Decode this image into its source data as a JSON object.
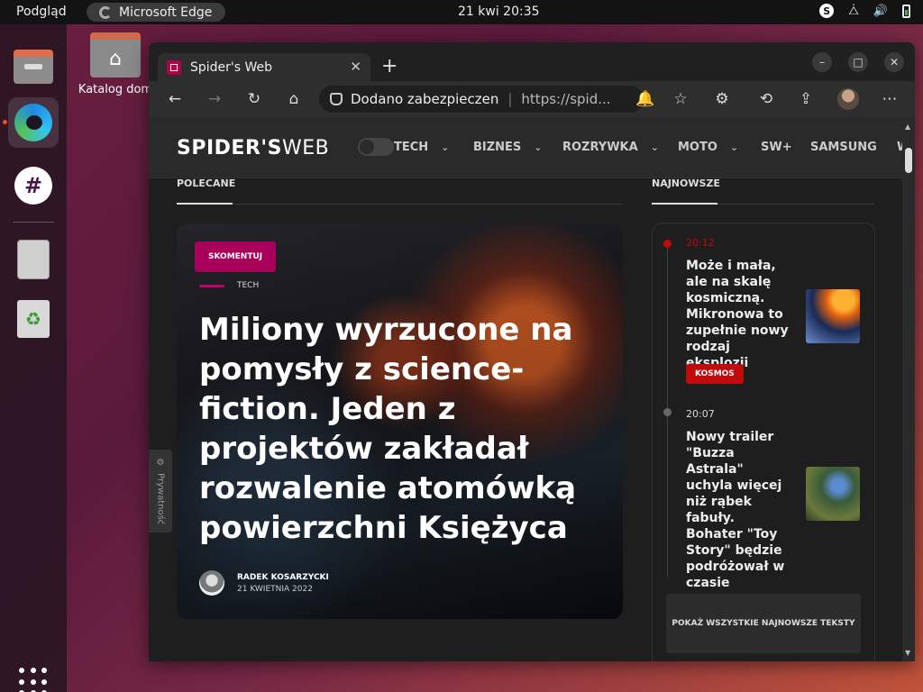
{
  "topbar": {
    "activities": "Podgląd",
    "app_name": "Microsoft Edge",
    "clock": "21 kwi  20:35"
  },
  "desktop": {
    "home_folder_label": "Katalog dom"
  },
  "browser": {
    "tab_title": "Spider's Web",
    "address_security": "Dodano zabezpieczen",
    "address_url": "https://spid..."
  },
  "site": {
    "logo_bold": "SPIDER'S",
    "logo_light": "WEB",
    "nav": [
      "TECH",
      "BIZNES",
      "ROZRYWKA",
      "MOTO",
      "SW+",
      "SAMSUNG",
      "W"
    ],
    "section_featured": "POLECANE",
    "section_latest": "NAJNOWSZE",
    "privacy": "Prywatność"
  },
  "hero": {
    "badge": "SKOMENTUJ",
    "category": "TECH",
    "title": "Miliony wyrzucone na pomysły z science-fiction. Jeden z projektów zakładał rozwalenie atomówką powierzchni Księżyca",
    "author": "RADEK KOSARZYCKI",
    "date": "21 KWIETNIA 2022"
  },
  "latest": {
    "items": [
      {
        "time": "20:12",
        "title": "Może i mała, ale na skalę kosmiczną. Mikronowa to zupełnie nowy rodzaj eksplozji",
        "tag": "KOSMOS"
      },
      {
        "time": "20:07",
        "title": "Nowy trailer \"Buzza Astrala\" uchyla więcej niż rąbek fabuły. Bohater \"Toy Story\" będzie podróżował w czasie"
      }
    ],
    "show_all": "POKAŻ WSZYSTKIE NAJNOWSZE TEKSTY"
  },
  "colors": {
    "accent_magenta": "#a8005a",
    "tag_red": "#c20a0a",
    "ubuntu_orange": "#e95420"
  }
}
